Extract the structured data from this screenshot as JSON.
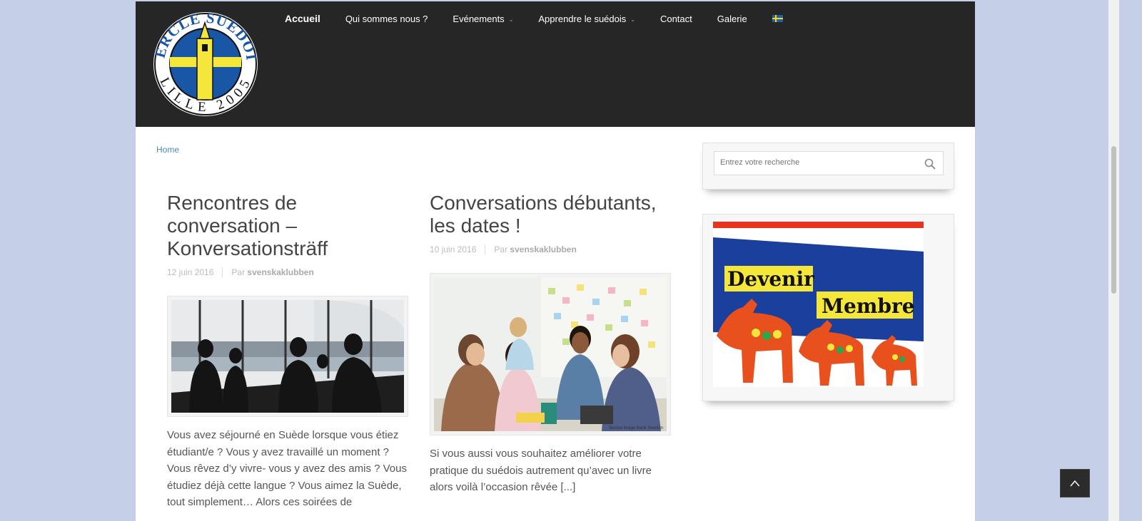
{
  "header": {
    "logo": {
      "top_text": "CERCLE SUEDOIS",
      "bottom_text": "LILLE 2005"
    },
    "nav": [
      {
        "label": "Accueil"
      },
      {
        "label": "Qui sommes nous ?"
      },
      {
        "label": "Evénements"
      },
      {
        "label": "Apprendre le suédois"
      },
      {
        "label": "Contact"
      },
      {
        "label": "Galerie"
      }
    ]
  },
  "breadcrumb": "Home",
  "posts": [
    {
      "title": "Rencontres de conversation – Konversationsträff",
      "date": "12 juin 2016",
      "by": "Par",
      "author": "svenskaklubben",
      "excerpt": "Vous avez séjourné en Suède lorsque vous étiez étudiant/e ? Vous y avez travaillé un moment ?  Vous rêvez d’y vivre- vous y avez des amis ? Vous étudiez déjà cette langue ? Vous aimez la Suède, tout simplement… Alors ces soirées de"
    },
    {
      "title": "Conversations débutants, les dates !",
      "date": "10 juin 2016",
      "by": "Par",
      "author": "svenskaklubben",
      "excerpt": "Si vous aussi vous souhaitez améliorer votre pratique du suédois autrement qu’avec un livre alors voilà l’occasion rêvée [...]",
      "image_caption": "Source Image Bank Sweden"
    }
  ],
  "sidebar": {
    "search_placeholder": "Entrez votre recherche",
    "banner": {
      "line1": "Devenir",
      "line2": "Membre"
    }
  },
  "colors": {
    "header_bg": "#262626",
    "page_bg": "#c5d0e8",
    "swedish_blue": "#1a56a6",
    "swedish_yellow": "#f5e63a",
    "dala_orange": "#e8501e"
  }
}
